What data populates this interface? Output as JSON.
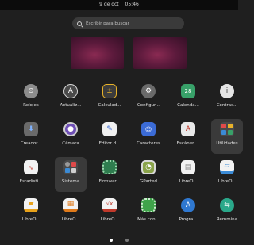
{
  "topbar": {
    "date": "9 de oct",
    "time": "05:46"
  },
  "search": {
    "placeholder": "Escribir para buscar"
  },
  "apps": [
    {
      "label": "Relojes",
      "icon": "clock-icon",
      "color": "#8c8c8c"
    },
    {
      "label": "Actualiz...",
      "icon": "software-updater-icon",
      "color": "#4a4a4a"
    },
    {
      "label": "Calculad...",
      "icon": "calculator-icon",
      "color": "#3c3c3c"
    },
    {
      "label": "Configur...",
      "icon": "settings-gear-icon",
      "color": "#6a6a6a"
    },
    {
      "label": "Calenda...",
      "icon": "calendar-icon",
      "color": "#38a169"
    },
    {
      "label": "Contras...",
      "icon": "passwords-keys-icon",
      "color": "#e5e5e5"
    },
    {
      "label": "Creador...",
      "icon": "startup-disk-creator-icon",
      "color": "#6a6a6a"
    },
    {
      "label": "Cámara",
      "icon": "camera-icon",
      "color": "#6f4fb5"
    },
    {
      "label": "Editor d...",
      "icon": "text-editor-icon",
      "color": "#f0f0f0"
    },
    {
      "label": "Caracteres",
      "icon": "characters-icon",
      "color": "#3b6bd6"
    },
    {
      "label": "Escáner ...",
      "icon": "document-scanner-icon",
      "color": "#e9e9e9"
    },
    {
      "label": "Utilidades",
      "icon": "utilities-folder-icon",
      "color": "#4a4a4a",
      "selected": true
    },
    {
      "label": "Estadísti...",
      "icon": "system-monitor-icon",
      "color": "#f2f2f2"
    },
    {
      "label": "Sistema",
      "icon": "system-folder-icon",
      "color": "#4a4a4a",
      "selected": true
    },
    {
      "label": "Firmwar...",
      "icon": "firmware-chip-icon",
      "color": "#2f7d4f"
    },
    {
      "label": "GParted",
      "icon": "gparted-icon",
      "color": "#8aa34a"
    },
    {
      "label": "LibreO...",
      "icon": "libreoffice-icon",
      "color": "#f2f2f2"
    },
    {
      "label": "LibreO...",
      "icon": "libreoffice-draw-icon",
      "color": "#3b8bd6"
    },
    {
      "label": "LibreO...",
      "icon": "libreoffice-impress-icon",
      "color": "#e8a21a"
    },
    {
      "label": "LibreO...",
      "icon": "libreoffice-math-icon",
      "color": "#e07a1a"
    },
    {
      "label": "LibreO...",
      "icon": "libreoffice-calc-icon",
      "color": "#c0392b"
    },
    {
      "label": "Más con...",
      "icon": "more-apps-icon",
      "color": "#3fa34a"
    },
    {
      "label": "Progra...",
      "icon": "software-center-icon",
      "color": "#2f78d0"
    },
    {
      "label": "Remmina",
      "icon": "remmina-icon",
      "color": "#2aa88a"
    }
  ],
  "pagination": {
    "pages": 2,
    "active": 0
  }
}
